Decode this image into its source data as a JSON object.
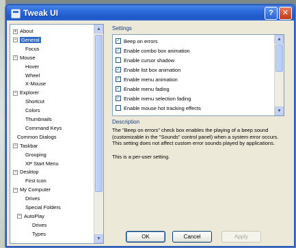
{
  "window": {
    "title": "Tweak UI",
    "help_label": "?",
    "close_label": "✕"
  },
  "tree": {
    "items": [
      {
        "label": "About",
        "expander": "+",
        "indent": 0
      },
      {
        "label": "General",
        "expander": "−",
        "indent": 0,
        "selected": true
      },
      {
        "label": "Focus",
        "indent": 2
      },
      {
        "label": "Mouse",
        "expander": "−",
        "indent": 0
      },
      {
        "label": "Hover",
        "indent": 2
      },
      {
        "label": "Wheel",
        "indent": 2
      },
      {
        "label": "X-Mouse",
        "indent": 2
      },
      {
        "label": "Explorer",
        "expander": "−",
        "indent": 0
      },
      {
        "label": "Shortcut",
        "indent": 2
      },
      {
        "label": "Colors",
        "indent": 2
      },
      {
        "label": "Thumbnails",
        "indent": 2
      },
      {
        "label": "Command Keys",
        "indent": 2
      },
      {
        "label": "Common Dialogs",
        "indent": 1
      },
      {
        "label": "Taskbar",
        "expander": "−",
        "indent": 0
      },
      {
        "label": "Grouping",
        "indent": 2
      },
      {
        "label": "XP Start Menu",
        "indent": 2
      },
      {
        "label": "Desktop",
        "expander": "−",
        "indent": 0
      },
      {
        "label": "First Icon",
        "indent": 2
      },
      {
        "label": "My Computer",
        "expander": "−",
        "indent": 0
      },
      {
        "label": "Drives",
        "indent": 2
      },
      {
        "label": "Special Folders",
        "indent": 2
      },
      {
        "label": "AutoPlay",
        "expander": "−",
        "indent": 1
      },
      {
        "label": "Drives",
        "indent": 3
      },
      {
        "label": "Types",
        "indent": 3
      }
    ]
  },
  "settings": {
    "label": "Settings",
    "items": [
      {
        "label": "Beep on errors",
        "checked": true
      },
      {
        "label": "Enable combo box animation",
        "checked": true
      },
      {
        "label": "Enable cursor shadow",
        "checked": false
      },
      {
        "label": "Enable list box animation",
        "checked": true
      },
      {
        "label": "Enable menu animation",
        "checked": true
      },
      {
        "label": "Enable menu fading",
        "checked": true
      },
      {
        "label": "Enable menu selection fading",
        "checked": true
      },
      {
        "label": "Enable mouse hot tracking effects",
        "checked": false
      }
    ]
  },
  "description": {
    "label": "Description",
    "paragraph1": "The \"Beep on errors\" check box enables the playing of a beep sound (customizable in the \"Sounds\" control panel) when a system error occurs. This setting does not affect custom error sounds played by applications.",
    "paragraph2": "This is a per-user setting."
  },
  "buttons": {
    "ok": "OK",
    "cancel": "Cancel",
    "apply": "Apply"
  },
  "colors": {
    "titlebar": "#2f6fe0",
    "selection": "#316ac5",
    "section_label": "#1a3a86"
  }
}
